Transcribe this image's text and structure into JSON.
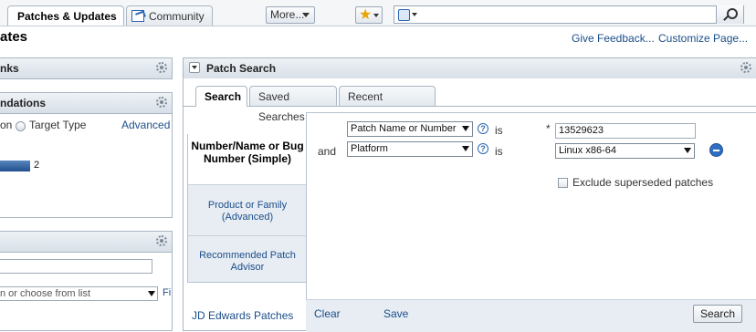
{
  "tabs": {
    "patches": "Patches & Updates",
    "community": "Community"
  },
  "toolbar": {
    "more_label": "More...",
    "favorites_icon": "star-icon",
    "search_value": "",
    "search_icon": "magnifier-icon"
  },
  "page": {
    "title_fragment": "ates",
    "feedback_link": "Give Feedback...",
    "customize_link": "Customize Page..."
  },
  "left": {
    "links_title": "nks",
    "reco_title": "ndations",
    "radio_option_cut": "on",
    "radio_target": "Target Type",
    "advanced_link": "Advanced",
    "bar_count": "2",
    "combo_placeholder": "n or choose from list",
    "combo_suffix": "Fi"
  },
  "patch_search": {
    "title": "Patch Search",
    "subtabs": [
      "Search",
      "Saved Searches",
      "Recent Searches"
    ],
    "nav": {
      "simple": "Number/Name or Bug Number (Simple)",
      "product": "Product or Family (Advanced)",
      "advisor": "Recommended Patch Advisor"
    },
    "jde_link": "JD Edwards Patches",
    "row1": {
      "field": "Patch Name or Number",
      "op": "is",
      "required_mark": "*",
      "value": "13529623"
    },
    "row2": {
      "conj": "and",
      "field": "Platform",
      "op": "is",
      "value": "Linux x86-64"
    },
    "exclude_label": "Exclude superseded patches",
    "actions": {
      "clear": "Clear",
      "save": "Save",
      "search": "Search"
    }
  },
  "colors": {
    "link": "#1c4e8a",
    "header_bg": "#d8dfe7",
    "accent_blue": "#2f6fc2"
  }
}
